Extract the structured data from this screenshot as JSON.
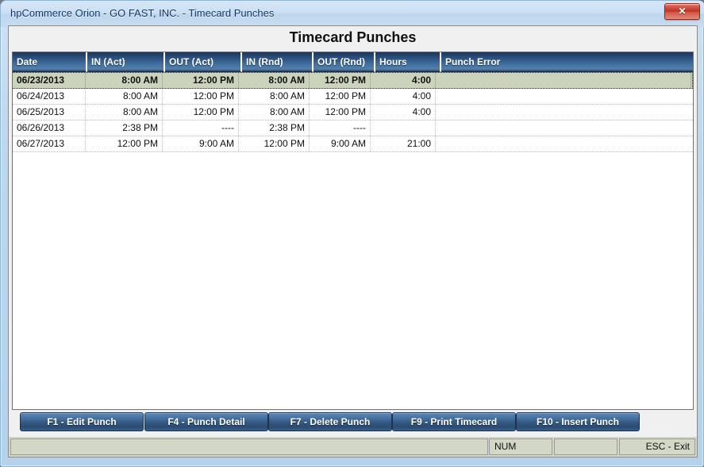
{
  "window": {
    "title": "hpCommerce Orion - GO FAST, INC. - Timecard Punches",
    "close_label": "✕"
  },
  "page": {
    "title": "Timecard Punches"
  },
  "grid": {
    "columns": [
      {
        "key": "date",
        "label": "Date",
        "align": "left"
      },
      {
        "key": "in_act",
        "label": "IN (Act)",
        "align": "right"
      },
      {
        "key": "out_act",
        "label": "OUT (Act)",
        "align": "right"
      },
      {
        "key": "in_rnd",
        "label": "IN (Rnd)",
        "align": "right"
      },
      {
        "key": "out_rnd",
        "label": "OUT (Rnd)",
        "align": "right"
      },
      {
        "key": "hours",
        "label": "Hours",
        "align": "right"
      },
      {
        "key": "error",
        "label": "Punch Error",
        "align": "left"
      }
    ],
    "rows": [
      {
        "date": "06/23/2013",
        "in_act": "8:00 AM",
        "out_act": "12:00 PM",
        "in_rnd": "8:00 AM",
        "out_rnd": "12:00 PM",
        "hours": "4:00",
        "error": "",
        "selected": true
      },
      {
        "date": "06/24/2013",
        "in_act": "8:00 AM",
        "out_act": "12:00 PM",
        "in_rnd": "8:00 AM",
        "out_rnd": "12:00 PM",
        "hours": "4:00",
        "error": "",
        "selected": false
      },
      {
        "date": "06/25/2013",
        "in_act": "8:00 AM",
        "out_act": "12:00 PM",
        "in_rnd": "8:00 AM",
        "out_rnd": "12:00 PM",
        "hours": "4:00",
        "error": "",
        "selected": false
      },
      {
        "date": "06/26/2013",
        "in_act": "2:38 PM",
        "out_act": "----",
        "in_rnd": "2:38 PM",
        "out_rnd": "----",
        "hours": "",
        "error": "",
        "selected": false
      },
      {
        "date": "06/27/2013",
        "in_act": "12:00 PM",
        "out_act": "9:00 AM",
        "in_rnd": "12:00 PM",
        "out_rnd": "9:00 AM",
        "hours": "21:00",
        "error": "",
        "selected": false
      }
    ]
  },
  "buttons": [
    {
      "label": "F1 - Edit Punch",
      "name": "edit-punch-button"
    },
    {
      "label": "F4 - Punch Detail",
      "name": "punch-detail-button"
    },
    {
      "label": "F7 - Delete Punch",
      "name": "delete-punch-button"
    },
    {
      "label": "F9 - Print Timecard",
      "name": "print-timecard-button"
    },
    {
      "label": "F10 - Insert Punch",
      "name": "insert-punch-button"
    }
  ],
  "statusbar": {
    "message": "",
    "num_lock": "NUM",
    "extra": "",
    "exit_hint": "ESC - Exit"
  },
  "colors": {
    "header_blue_top": "#1d3557",
    "header_blue_bottom": "#547fab",
    "selected_row": "#ccd3bc",
    "button_blue": "#34587f",
    "status_bg": "#d2d7c6",
    "frame_blue": "#bcd7ef",
    "close_red": "#b93226"
  }
}
